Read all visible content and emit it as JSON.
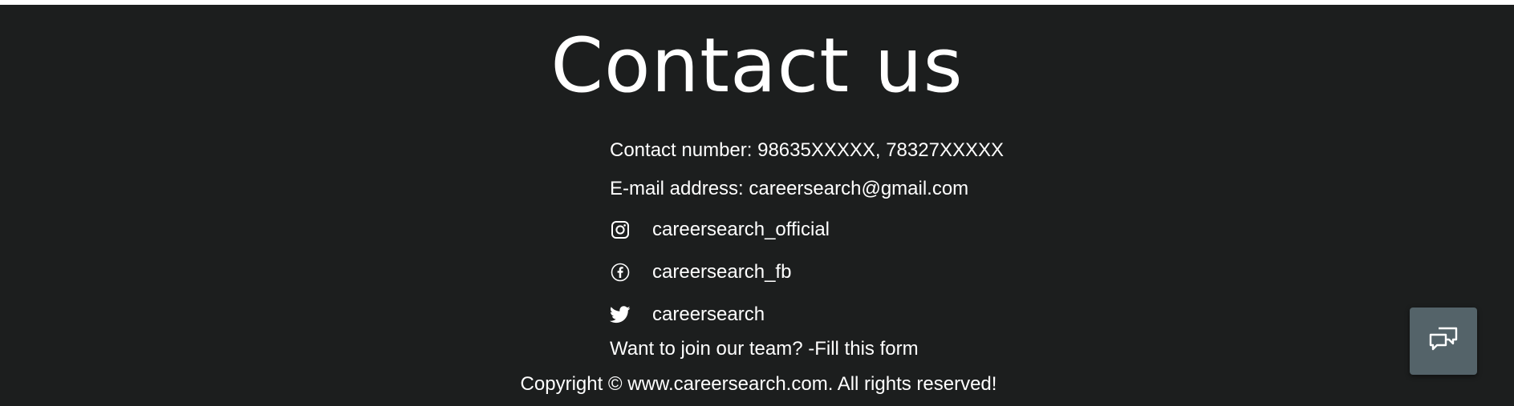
{
  "footer": {
    "title": "Contact us",
    "contact_number": "Contact number: 98635XXXXX, 78327XXXXX",
    "email": "E-mail address: careersearch@gmail.com",
    "socials": [
      {
        "icon": "instagram-icon",
        "label": "careersearch_official"
      },
      {
        "icon": "facebook-icon",
        "label": "careersearch_fb"
      },
      {
        "icon": "twitter-icon",
        "label": "careersearch"
      }
    ],
    "join_team": "Want to join our team? -Fill this form",
    "copyright": "Copyright © www.careersearch.com. All rights reserved!"
  },
  "chat_button": {
    "icon": "chat-bubbles-icon"
  },
  "colors": {
    "background": "#1c1e1e",
    "text": "#ffffff",
    "chat_button": "#546369"
  }
}
